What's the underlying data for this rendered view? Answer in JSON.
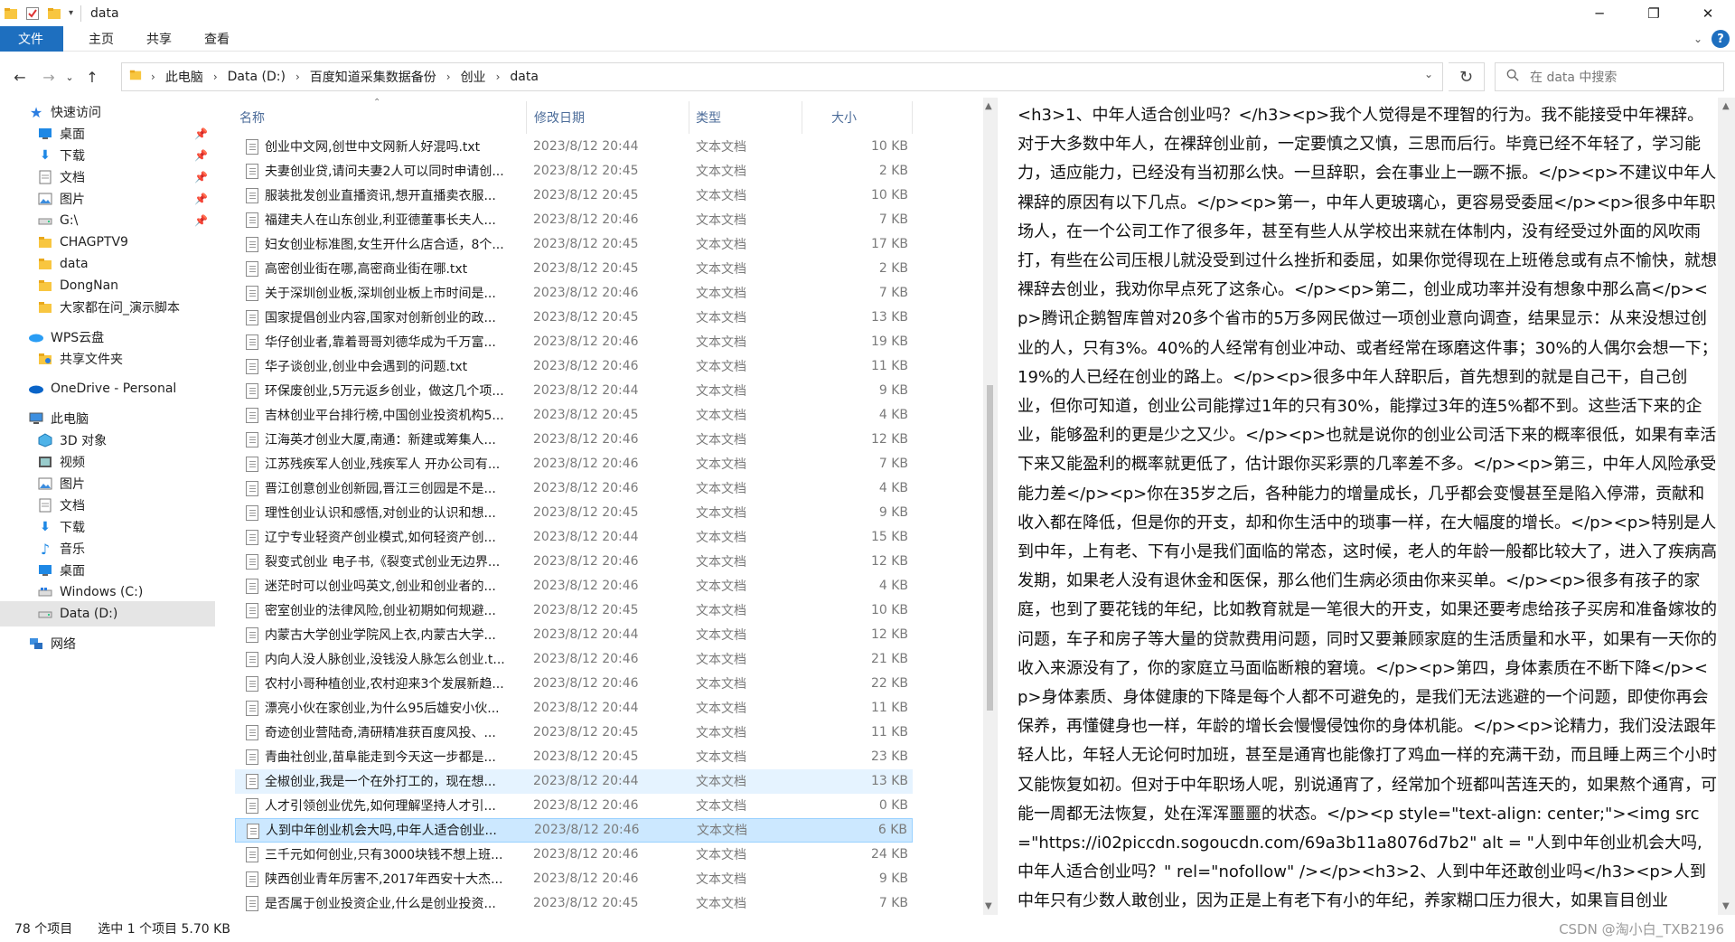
{
  "window": {
    "title": "data",
    "controls": {
      "minimize": "─",
      "maximize": "❐",
      "close": "✕"
    }
  },
  "ribbon": {
    "tabs": [
      "文件",
      "主页",
      "共享",
      "查看"
    ]
  },
  "address": {
    "crumbs": [
      "此电脑",
      "Data (D:)",
      "百度知道采集数据备份",
      "创业",
      "data"
    ],
    "search_placeholder": "在 data 中搜索"
  },
  "nav": {
    "items": [
      {
        "label": "快速访问",
        "icon": "star-icon",
        "pinned": false
      },
      {
        "label": "桌面",
        "icon": "desktop-icon",
        "pinned": true
      },
      {
        "label": "下载",
        "icon": "download-icon",
        "pinned": true
      },
      {
        "label": "文档",
        "icon": "document-icon",
        "pinned": true
      },
      {
        "label": "图片",
        "icon": "picture-icon",
        "pinned": true
      },
      {
        "label": "G:\\",
        "icon": "drive-icon",
        "pinned": true
      },
      {
        "label": "CHAGPTV9",
        "icon": "folder-icon",
        "pinned": false
      },
      {
        "label": "data",
        "icon": "folder-icon",
        "pinned": false
      },
      {
        "label": "DongNan",
        "icon": "folder-icon",
        "pinned": false
      },
      {
        "label": "大家都在问_演示脚本",
        "icon": "folder-icon",
        "pinned": false
      },
      {
        "label": "WPS云盘",
        "icon": "cloud-icon",
        "pinned": false
      },
      {
        "label": "共享文件夹",
        "icon": "shared-folder-icon",
        "pinned": false
      },
      {
        "label": "OneDrive - Personal",
        "icon": "onedrive-icon",
        "pinned": false
      },
      {
        "label": "此电脑",
        "icon": "computer-icon",
        "pinned": false
      },
      {
        "label": "3D 对象",
        "icon": "cube-icon",
        "pinned": false
      },
      {
        "label": "视频",
        "icon": "video-icon",
        "pinned": false
      },
      {
        "label": "图片",
        "icon": "picture-icon",
        "pinned": false
      },
      {
        "label": "文档",
        "icon": "document-icon",
        "pinned": false
      },
      {
        "label": "下载",
        "icon": "download-icon",
        "pinned": false
      },
      {
        "label": "音乐",
        "icon": "music-icon",
        "pinned": false
      },
      {
        "label": "桌面",
        "icon": "desktop-icon",
        "pinned": false
      },
      {
        "label": "Windows (C:)",
        "icon": "windows-drive-icon",
        "pinned": false
      },
      {
        "label": "Data (D:)",
        "icon": "drive-icon",
        "pinned": false
      },
      {
        "label": "网络",
        "icon": "network-icon",
        "pinned": false
      }
    ]
  },
  "columns": {
    "name": "名称",
    "date": "修改日期",
    "type": "类型",
    "size": "大小"
  },
  "files": [
    {
      "name": "创业中文网,创世中文网新人好混吗.txt",
      "date": "2023/8/12 20:44",
      "type": "文本文档",
      "size": "10 KB"
    },
    {
      "name": "夫妻创业贷,请问夫妻2人可以同时申请创...",
      "date": "2023/8/12 20:45",
      "type": "文本文档",
      "size": "2 KB"
    },
    {
      "name": "服装批发创业直播资讯,想开直播卖衣服...",
      "date": "2023/8/12 20:45",
      "type": "文本文档",
      "size": "10 KB"
    },
    {
      "name": "福建夫人在山东创业,利亚德董事长夫人...",
      "date": "2023/8/12 20:46",
      "type": "文本文档",
      "size": "7 KB"
    },
    {
      "name": "妇女创业标准图,女生开什么店合适，8个...",
      "date": "2023/8/12 20:45",
      "type": "文本文档",
      "size": "17 KB"
    },
    {
      "name": "高密创业街在哪,高密商业街在哪.txt",
      "date": "2023/8/12 20:45",
      "type": "文本文档",
      "size": "2 KB"
    },
    {
      "name": "关于深圳创业板,深圳创业板上市时间是...",
      "date": "2023/8/12 20:46",
      "type": "文本文档",
      "size": "7 KB"
    },
    {
      "name": "国家提倡创业内容,国家对创新创业的政...",
      "date": "2023/8/12 20:45",
      "type": "文本文档",
      "size": "13 KB"
    },
    {
      "name": "华仔创业者,靠着哥哥刘德华成为千万富...",
      "date": "2023/8/12 20:46",
      "type": "文本文档",
      "size": "19 KB"
    },
    {
      "name": "华子谈创业,创业中会遇到的问题.txt",
      "date": "2023/8/12 20:46",
      "type": "文本文档",
      "size": "11 KB"
    },
    {
      "name": "环保废创业,5万元返乡创业，做这几个项...",
      "date": "2023/8/12 20:44",
      "type": "文本文档",
      "size": "9 KB"
    },
    {
      "name": "吉林创业平台排行榜,中国创业投资机构5...",
      "date": "2023/8/12 20:45",
      "type": "文本文档",
      "size": "4 KB"
    },
    {
      "name": "江海英才创业大厦,南通：新建或筹集人...",
      "date": "2023/8/12 20:46",
      "type": "文本文档",
      "size": "12 KB"
    },
    {
      "name": "江苏残疾军人创业,残疾军人 开办公司有...",
      "date": "2023/8/12 20:46",
      "type": "文本文档",
      "size": "7 KB"
    },
    {
      "name": "晋江创意创业创新园,晋江三创园是不是...",
      "date": "2023/8/12 20:46",
      "type": "文本文档",
      "size": "4 KB"
    },
    {
      "name": "理性创业认识和感悟,对创业的认识和想...",
      "date": "2023/8/12 20:45",
      "type": "文本文档",
      "size": "9 KB"
    },
    {
      "name": "辽宁专业轻资产创业模式,如何轻资产创...",
      "date": "2023/8/12 20:44",
      "type": "文本文档",
      "size": "15 KB"
    },
    {
      "name": "裂变式创业 电子书,《裂变式创业无边界...",
      "date": "2023/8/12 20:46",
      "type": "文本文档",
      "size": "12 KB"
    },
    {
      "name": "迷茫时可以创业吗英文,创业和创业者的...",
      "date": "2023/8/12 20:46",
      "type": "文本文档",
      "size": "4 KB"
    },
    {
      "name": "密室创业的法律风险,创业初期如何规避...",
      "date": "2023/8/12 20:45",
      "type": "文本文档",
      "size": "10 KB"
    },
    {
      "name": "内蒙古大学创业学院风上衣,内蒙古大学...",
      "date": "2023/8/12 20:44",
      "type": "文本文档",
      "size": "12 KB"
    },
    {
      "name": "内向人没人脉创业,没钱没人脉怎么创业.t...",
      "date": "2023/8/12 20:46",
      "type": "文本文档",
      "size": "21 KB"
    },
    {
      "name": "农村小哥种植创业,农村迎来3个发展新趋...",
      "date": "2023/8/12 20:46",
      "type": "文本文档",
      "size": "22 KB"
    },
    {
      "name": "漂亮小伙在家创业,为什么95后雄安小伙...",
      "date": "2023/8/12 20:44",
      "type": "文本文档",
      "size": "11 KB"
    },
    {
      "name": "奇迹创业营陆奇,清研精准获百度风投、...",
      "date": "2023/8/12 20:45",
      "type": "文本文档",
      "size": "11 KB"
    },
    {
      "name": "青曲社创业,苗阜能走到今天这一步都是...",
      "date": "2023/8/12 20:45",
      "type": "文本文档",
      "size": "23 KB"
    },
    {
      "name": "全椒创业,我是一个在外打工的，现在想...",
      "date": "2023/8/12 20:44",
      "type": "文本文档",
      "size": "13 KB"
    },
    {
      "name": "人才引领创业优先,如何理解坚持人才引...",
      "date": "2023/8/12 20:46",
      "type": "文本文档",
      "size": "0 KB"
    },
    {
      "name": "人到中年创业机会大吗,中年人适合创业...",
      "date": "2023/8/12 20:46",
      "type": "文本文档",
      "size": "6 KB"
    },
    {
      "name": "三千元如何创业,只有3000块钱不想上班...",
      "date": "2023/8/12 20:46",
      "type": "文本文档",
      "size": "24 KB"
    },
    {
      "name": "陕西创业青年厉害不,2017年西安十大杰...",
      "date": "2023/8/12 20:46",
      "type": "文本文档",
      "size": "9 KB"
    },
    {
      "name": "是否属于创业投资企业,什么是创业投资...",
      "date": "2023/8/12 20:45",
      "type": "文本文档",
      "size": "7 KB"
    }
  ],
  "preview": {
    "text": "<h3>1、中年人适合创业吗？</h3><p>我个人觉得是不理智的行为。我不能接受中年裸辞。对于大多数中年人，在裸辞创业前，一定要慎之又慎，三思而后行。毕竟已经不年轻了，学习能力，适应能力，已经没有当初那么快。一旦辞职，会在事业上一蹶不振。</p><p>不建议中年人裸辞的原因有以下几点。</p><p>第一，中年人更玻璃心，更容易受委屈</p><p>很多中年职场人，在一个公司工作了很多年，甚至有些人从学校出来就在体制内，没有经受过外面的风吹雨打，有些在公司压根儿就没受到过什么挫折和委屈，如果你觉得现在上班倦怠或有点不愉快，就想裸辞去创业，我劝你早点死了这条心。</p><p>第二，创业成功率并没有想象中那么高</p><p>腾讯企鹅智库曾对20多个省市的5万多网民做过一项创业意向调查，结果显示：从来没想过创业的人，只有3%。40%的人经常有创业冲动、或者经常在琢磨这件事；30%的人偶尔会想一下；19%的人已经在创业的路上。</p><p>很多中年人辞职后，首先想到的就是自己干，自己创业，但你可知道，创业公司能撑过1年的只有30%，能撑过3年的连5%都不到。这些活下来的企业，能够盈利的更是少之又少。</p><p>也就是说你的创业公司活下来的概率很低，如果有幸活下来又能盈利的概率就更低了，估计跟你买彩票的几率差不多。</p><p>第三，中年人风险承受能力差</p><p>你在35岁之后，各种能力的增量成长，几乎都会变慢甚至是陷入停滞，贡献和收入都在降低，但是你的开支，却和你生活中的琐事一样，在大幅度的增长。</p><p>特别是人到中年，上有老、下有小是我们面临的常态，这时候，老人的年龄一般都比较大了，进入了疾病高发期，如果老人没有退休金和医保，那么他们生病必须由你来买单。</p><p>很多有孩子的家庭，也到了要花钱的年纪，比如教育就是一笔很大的开支，如果还要考虑给孩子买房和准备嫁妆的问题，车子和房子等大量的贷款费用问题，同时又要兼顾家庭的生活质量和水平，如果有一天你的收入来源没有了，你的家庭立马面临断粮的窘境。</p><p>第四，身体素质在不断下降</p><p>身体素质、身体健康的下降是每个人都不可避免的，是我们无法逃避的一个问题，即使你再会保养，再懂健身也一样，年龄的增长会慢慢侵蚀你的身体机能。</p><p>论精力，我们没法跟年轻人比，年轻人无论何时加班，甚至是通宵也能像打了鸡血一样的充满干劲，而且睡上两三个小时又能恢复如初。但对于中年职场人呢，别说通宵了，经常加个班都叫苦连天的，如果熬个通宵，可能一周都无法恢复，处在浑浑噩噩的状态。</p><p style=\"text-align: center;\"><img src=\"https://i02piccdn.sogoucdn.com/69a3b11a8076d7b2\" alt = \"人到中年创业机会大吗,中年人适合创业吗？\" rel=\"nofollow\" /></p><h3>2、人到中年还敢创业吗</h3><p>人到中年只有少数人敢创业，因为正是上有老下有小的年纪，养家糊口压力很大，如果盲目创业"
  },
  "status": {
    "count": "78 个项目",
    "selection": "选中 1 个项目  5.70 KB"
  },
  "watermark": "CSDN @淘小白_TXB2196",
  "colors": {
    "accent": "#1e6fbf",
    "selected_row": "#cce8ff",
    "hover_row": "#e5f3ff",
    "header_text": "#4d6d9a"
  }
}
